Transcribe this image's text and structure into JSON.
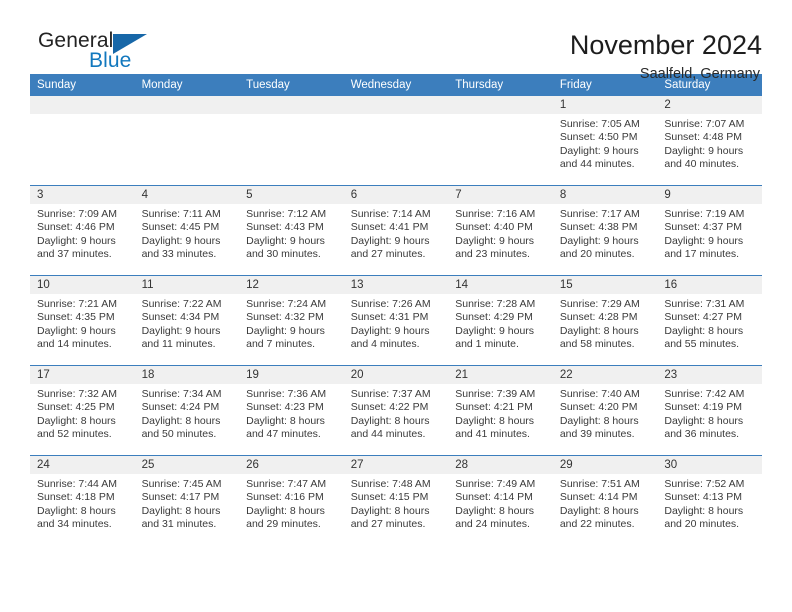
{
  "brand": {
    "name_part1": "General",
    "name_part2": "Blue",
    "accent_color": "#1767a8",
    "blue_text_color": "#1278be"
  },
  "header": {
    "title": "November 2024",
    "subtitle": "Saalfeld, Germany"
  },
  "calendar": {
    "header_bg": "#3c7ebd",
    "daynum_bg": "#f0f0f0",
    "weekday_headers": [
      "Sunday",
      "Monday",
      "Tuesday",
      "Wednesday",
      "Thursday",
      "Friday",
      "Saturday"
    ],
    "weeks": [
      [
        {
          "day": "",
          "sunrise": "",
          "sunset": "",
          "daylight_line1": "",
          "daylight_line2": ""
        },
        {
          "day": "",
          "sunrise": "",
          "sunset": "",
          "daylight_line1": "",
          "daylight_line2": ""
        },
        {
          "day": "",
          "sunrise": "",
          "sunset": "",
          "daylight_line1": "",
          "daylight_line2": ""
        },
        {
          "day": "",
          "sunrise": "",
          "sunset": "",
          "daylight_line1": "",
          "daylight_line2": ""
        },
        {
          "day": "",
          "sunrise": "",
          "sunset": "",
          "daylight_line1": "",
          "daylight_line2": ""
        },
        {
          "day": "1",
          "sunrise": "Sunrise: 7:05 AM",
          "sunset": "Sunset: 4:50 PM",
          "daylight_line1": "Daylight: 9 hours",
          "daylight_line2": "and 44 minutes."
        },
        {
          "day": "2",
          "sunrise": "Sunrise: 7:07 AM",
          "sunset": "Sunset: 4:48 PM",
          "daylight_line1": "Daylight: 9 hours",
          "daylight_line2": "and 40 minutes."
        }
      ],
      [
        {
          "day": "3",
          "sunrise": "Sunrise: 7:09 AM",
          "sunset": "Sunset: 4:46 PM",
          "daylight_line1": "Daylight: 9 hours",
          "daylight_line2": "and 37 minutes."
        },
        {
          "day": "4",
          "sunrise": "Sunrise: 7:11 AM",
          "sunset": "Sunset: 4:45 PM",
          "daylight_line1": "Daylight: 9 hours",
          "daylight_line2": "and 33 minutes."
        },
        {
          "day": "5",
          "sunrise": "Sunrise: 7:12 AM",
          "sunset": "Sunset: 4:43 PM",
          "daylight_line1": "Daylight: 9 hours",
          "daylight_line2": "and 30 minutes."
        },
        {
          "day": "6",
          "sunrise": "Sunrise: 7:14 AM",
          "sunset": "Sunset: 4:41 PM",
          "daylight_line1": "Daylight: 9 hours",
          "daylight_line2": "and 27 minutes."
        },
        {
          "day": "7",
          "sunrise": "Sunrise: 7:16 AM",
          "sunset": "Sunset: 4:40 PM",
          "daylight_line1": "Daylight: 9 hours",
          "daylight_line2": "and 23 minutes."
        },
        {
          "day": "8",
          "sunrise": "Sunrise: 7:17 AM",
          "sunset": "Sunset: 4:38 PM",
          "daylight_line1": "Daylight: 9 hours",
          "daylight_line2": "and 20 minutes."
        },
        {
          "day": "9",
          "sunrise": "Sunrise: 7:19 AM",
          "sunset": "Sunset: 4:37 PM",
          "daylight_line1": "Daylight: 9 hours",
          "daylight_line2": "and 17 minutes."
        }
      ],
      [
        {
          "day": "10",
          "sunrise": "Sunrise: 7:21 AM",
          "sunset": "Sunset: 4:35 PM",
          "daylight_line1": "Daylight: 9 hours",
          "daylight_line2": "and 14 minutes."
        },
        {
          "day": "11",
          "sunrise": "Sunrise: 7:22 AM",
          "sunset": "Sunset: 4:34 PM",
          "daylight_line1": "Daylight: 9 hours",
          "daylight_line2": "and 11 minutes."
        },
        {
          "day": "12",
          "sunrise": "Sunrise: 7:24 AM",
          "sunset": "Sunset: 4:32 PM",
          "daylight_line1": "Daylight: 9 hours",
          "daylight_line2": "and 7 minutes."
        },
        {
          "day": "13",
          "sunrise": "Sunrise: 7:26 AM",
          "sunset": "Sunset: 4:31 PM",
          "daylight_line1": "Daylight: 9 hours",
          "daylight_line2": "and 4 minutes."
        },
        {
          "day": "14",
          "sunrise": "Sunrise: 7:28 AM",
          "sunset": "Sunset: 4:29 PM",
          "daylight_line1": "Daylight: 9 hours",
          "daylight_line2": "and 1 minute."
        },
        {
          "day": "15",
          "sunrise": "Sunrise: 7:29 AM",
          "sunset": "Sunset: 4:28 PM",
          "daylight_line1": "Daylight: 8 hours",
          "daylight_line2": "and 58 minutes."
        },
        {
          "day": "16",
          "sunrise": "Sunrise: 7:31 AM",
          "sunset": "Sunset: 4:27 PM",
          "daylight_line1": "Daylight: 8 hours",
          "daylight_line2": "and 55 minutes."
        }
      ],
      [
        {
          "day": "17",
          "sunrise": "Sunrise: 7:32 AM",
          "sunset": "Sunset: 4:25 PM",
          "daylight_line1": "Daylight: 8 hours",
          "daylight_line2": "and 52 minutes."
        },
        {
          "day": "18",
          "sunrise": "Sunrise: 7:34 AM",
          "sunset": "Sunset: 4:24 PM",
          "daylight_line1": "Daylight: 8 hours",
          "daylight_line2": "and 50 minutes."
        },
        {
          "day": "19",
          "sunrise": "Sunrise: 7:36 AM",
          "sunset": "Sunset: 4:23 PM",
          "daylight_line1": "Daylight: 8 hours",
          "daylight_line2": "and 47 minutes."
        },
        {
          "day": "20",
          "sunrise": "Sunrise: 7:37 AM",
          "sunset": "Sunset: 4:22 PM",
          "daylight_line1": "Daylight: 8 hours",
          "daylight_line2": "and 44 minutes."
        },
        {
          "day": "21",
          "sunrise": "Sunrise: 7:39 AM",
          "sunset": "Sunset: 4:21 PM",
          "daylight_line1": "Daylight: 8 hours",
          "daylight_line2": "and 41 minutes."
        },
        {
          "day": "22",
          "sunrise": "Sunrise: 7:40 AM",
          "sunset": "Sunset: 4:20 PM",
          "daylight_line1": "Daylight: 8 hours",
          "daylight_line2": "and 39 minutes."
        },
        {
          "day": "23",
          "sunrise": "Sunrise: 7:42 AM",
          "sunset": "Sunset: 4:19 PM",
          "daylight_line1": "Daylight: 8 hours",
          "daylight_line2": "and 36 minutes."
        }
      ],
      [
        {
          "day": "24",
          "sunrise": "Sunrise: 7:44 AM",
          "sunset": "Sunset: 4:18 PM",
          "daylight_line1": "Daylight: 8 hours",
          "daylight_line2": "and 34 minutes."
        },
        {
          "day": "25",
          "sunrise": "Sunrise: 7:45 AM",
          "sunset": "Sunset: 4:17 PM",
          "daylight_line1": "Daylight: 8 hours",
          "daylight_line2": "and 31 minutes."
        },
        {
          "day": "26",
          "sunrise": "Sunrise: 7:47 AM",
          "sunset": "Sunset: 4:16 PM",
          "daylight_line1": "Daylight: 8 hours",
          "daylight_line2": "and 29 minutes."
        },
        {
          "day": "27",
          "sunrise": "Sunrise: 7:48 AM",
          "sunset": "Sunset: 4:15 PM",
          "daylight_line1": "Daylight: 8 hours",
          "daylight_line2": "and 27 minutes."
        },
        {
          "day": "28",
          "sunrise": "Sunrise: 7:49 AM",
          "sunset": "Sunset: 4:14 PM",
          "daylight_line1": "Daylight: 8 hours",
          "daylight_line2": "and 24 minutes."
        },
        {
          "day": "29",
          "sunrise": "Sunrise: 7:51 AM",
          "sunset": "Sunset: 4:14 PM",
          "daylight_line1": "Daylight: 8 hours",
          "daylight_line2": "and 22 minutes."
        },
        {
          "day": "30",
          "sunrise": "Sunrise: 7:52 AM",
          "sunset": "Sunset: 4:13 PM",
          "daylight_line1": "Daylight: 8 hours",
          "daylight_line2": "and 20 minutes."
        }
      ]
    ]
  }
}
